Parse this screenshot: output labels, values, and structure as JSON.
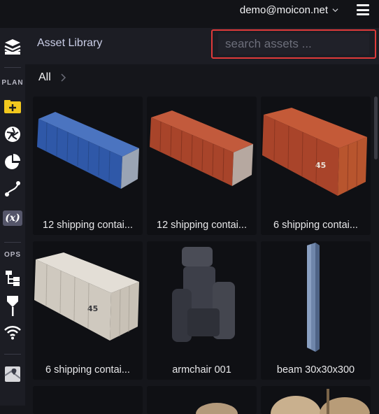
{
  "topbar": {
    "user_email": "demo@moicon.net"
  },
  "sidebar": {
    "plan_label": "PLAN",
    "ops_label": "OPS",
    "variable_icon_text": "(x)",
    "icons": {
      "layers": "layers-icon",
      "add": "add-icon",
      "aperture": "aperture-icon",
      "pie": "pie-chart-icon",
      "path": "path-icon",
      "variable": "variable-icon",
      "tree": "tree-icon",
      "marker": "marker-icon",
      "wifi": "wifi-icon",
      "map": "map-icon"
    },
    "accent_color": "#f2c81e"
  },
  "panel": {
    "title": "Asset Library",
    "search_placeholder": "search assets ..."
  },
  "breadcrumb": {
    "root": "All"
  },
  "assets": [
    {
      "label": "12 shipping contai...",
      "color": "#2e5aa8"
    },
    {
      "label": "12 shipping contai...",
      "color": "#b24a2e"
    },
    {
      "label": "6 shipping contai...",
      "color": "#b84a2c"
    },
    {
      "label": "6 shipping contai...",
      "color": "#cfcac2"
    },
    {
      "label": "armchair 001",
      "color": "#3a3c45"
    },
    {
      "label": "beam 30x30x300",
      "color": "#6d84a8"
    }
  ],
  "highlight_color": "#e03a3a"
}
